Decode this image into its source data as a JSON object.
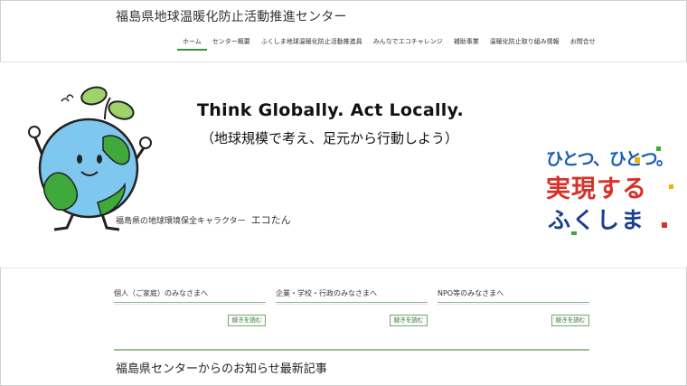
{
  "header": {
    "site_title": "福島県地球温暖化防止活動推進センター",
    "nav": [
      {
        "label": "ホーム"
      },
      {
        "label": "センター概要"
      },
      {
        "label": "ふくしま地球温暖化防止活動推進員"
      },
      {
        "label": "みんなでエコチャレンジ"
      },
      {
        "label": "補助事業"
      },
      {
        "label": "温暖化防止取り組み情報"
      },
      {
        "label": "お問合せ"
      }
    ]
  },
  "hero": {
    "tagline_en": "Think Globally. Act Locally.",
    "tagline_jp": "（地球規模で考え、足元から行動しよう）",
    "mascot_caption": "福島県の地球環境保全キャラクター",
    "mascot_name": "エコたん",
    "slogan_lines": [
      "ひとつ、ひとつ。",
      "実現する",
      "ふくしま"
    ]
  },
  "sections": [
    {
      "title": "個人（ご家庭）のみなさまへ",
      "more_label": "続きを読む"
    },
    {
      "title": "企業・学校・行政のみなさまへ",
      "more_label": "続きを読む"
    },
    {
      "title": "NPO等のみなさまへ",
      "more_label": "続きを読む"
    }
  ],
  "news": {
    "heading": "福島県センターからのお知らせ最新記事"
  },
  "colors": {
    "accent_green": "#3a8f3a",
    "earth_blue": "#7ec8ef",
    "earth_green": "#3fa93c"
  }
}
